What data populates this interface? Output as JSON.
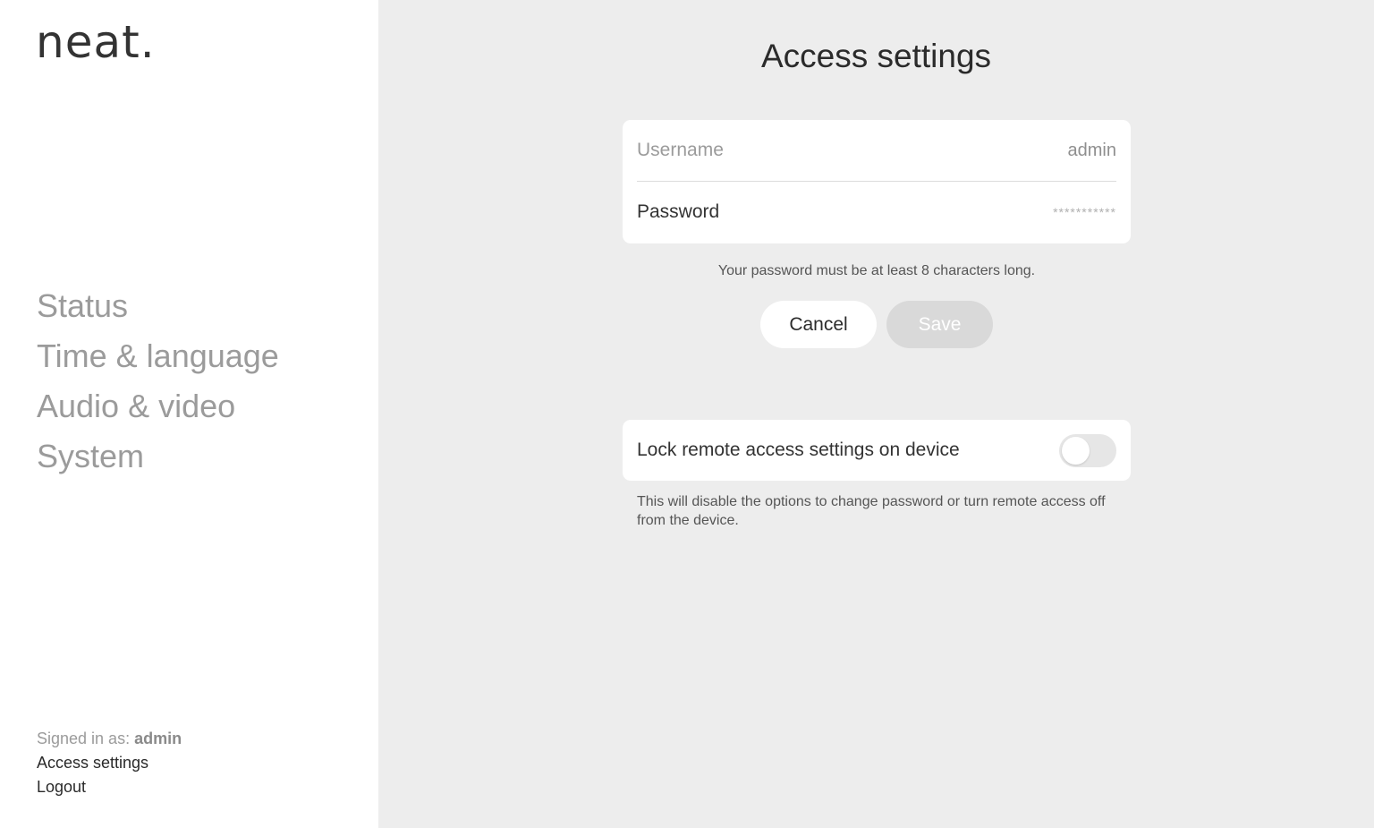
{
  "sidebar": {
    "logo": "neat.",
    "nav": [
      {
        "label": "Status"
      },
      {
        "label": "Time & language"
      },
      {
        "label": "Audio & video"
      },
      {
        "label": "System"
      }
    ],
    "signed_in_prefix": "Signed in as: ",
    "signed_in_user": "admin",
    "access_settings_link": "Access settings",
    "logout_link": "Logout"
  },
  "main": {
    "title": "Access settings",
    "username": {
      "label": "Username",
      "value": "admin"
    },
    "password": {
      "label": "Password",
      "value": "***********"
    },
    "hint": "Your password must be at least 8 characters long.",
    "cancel_label": "Cancel",
    "save_label": "Save",
    "lock": {
      "label": "Lock remote access settings on device",
      "enabled": false,
      "description": "This will disable the options to change password or turn remote access off from the device."
    }
  },
  "colors": {
    "sidebar_bg": "#ffffff",
    "main_bg": "#ededed",
    "nav_text": "#9b9b9b",
    "save_disabled": "#d9d9d9"
  }
}
